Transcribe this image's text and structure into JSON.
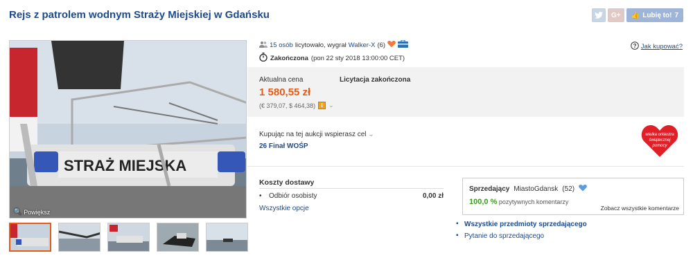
{
  "title": "Rejs z patrolem wodnym Straży Miejskiej w Gdańsku",
  "social": {
    "twitter_icon": "twitter-icon",
    "gplus_label": "G+",
    "fb_label": "Lubię to!",
    "fb_count": "7"
  },
  "gallery": {
    "zoom_label": "Powiększ",
    "photo_text": "STRAŻ MIEJSKA",
    "thumb_count": 5
  },
  "stats": {
    "people": "15 osób",
    "bid_text": "licytowało, wygrał",
    "winner": "Walker-X",
    "winner_score": "(6)"
  },
  "status": {
    "state": "Zakończona",
    "date": "(pon 22 sty 2018 13:00:00 CET)"
  },
  "how_to_buy": "Jak kupować?",
  "price": {
    "label": "Aktualna cena",
    "value": "1 580,55 zł",
    "conversion": "(€ 379,07, $ 464,38)",
    "ended": "Licytacja zakończona"
  },
  "charity": {
    "text": "Kupując na tej aukcji wspierasz cel",
    "link": "26 Finał WOŚP",
    "heart_text": [
      "wielka orkiestra",
      "świątecznej",
      "pomocy"
    ]
  },
  "shipping": {
    "title": "Koszty dostawy",
    "rows": [
      {
        "label": "Odbiór osobisty",
        "value": "0,00 zł"
      }
    ],
    "all_options": "Wszystkie opcje"
  },
  "seller": {
    "role": "Sprzedający",
    "name": "MiastoGdansk",
    "count": "(52)",
    "positive_pct": "100,0 %",
    "positive_text": "pozytywnych komentarzy",
    "see_all": "Zobacz wszystkie komentarze",
    "link_items": "Wszystkie przedmioty sprzedającego",
    "link_ask": "Pytanie do sprzedającego"
  },
  "colors": {
    "accent": "#e85a14",
    "link": "#1d4a8c",
    "positive": "#3a9b1e"
  }
}
